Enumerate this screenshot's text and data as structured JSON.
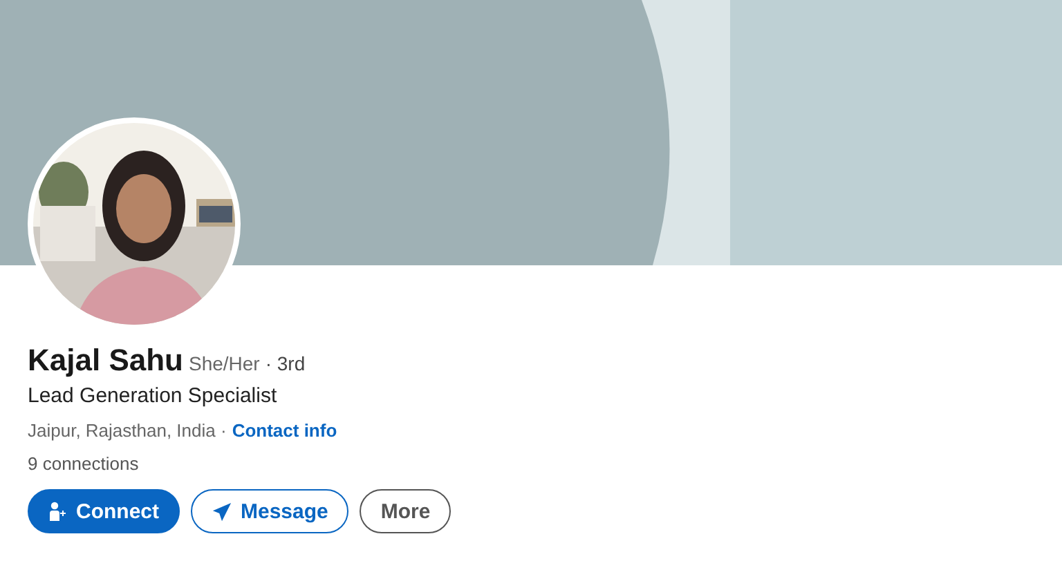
{
  "profile": {
    "name": "Kajal Sahu",
    "pronouns": "She/Her",
    "degree": "· 3rd",
    "headline": "Lead Generation Specialist",
    "location": "Jaipur, Rajasthan, India ·",
    "contact_link": "Contact info",
    "connections": "9 connections"
  },
  "actions": [
    {
      "kind": "primary",
      "label": "Connect"
    },
    {
      "kind": "secondary",
      "label": "Message"
    },
    {
      "kind": "tertiary",
      "label": "More"
    }
  ]
}
